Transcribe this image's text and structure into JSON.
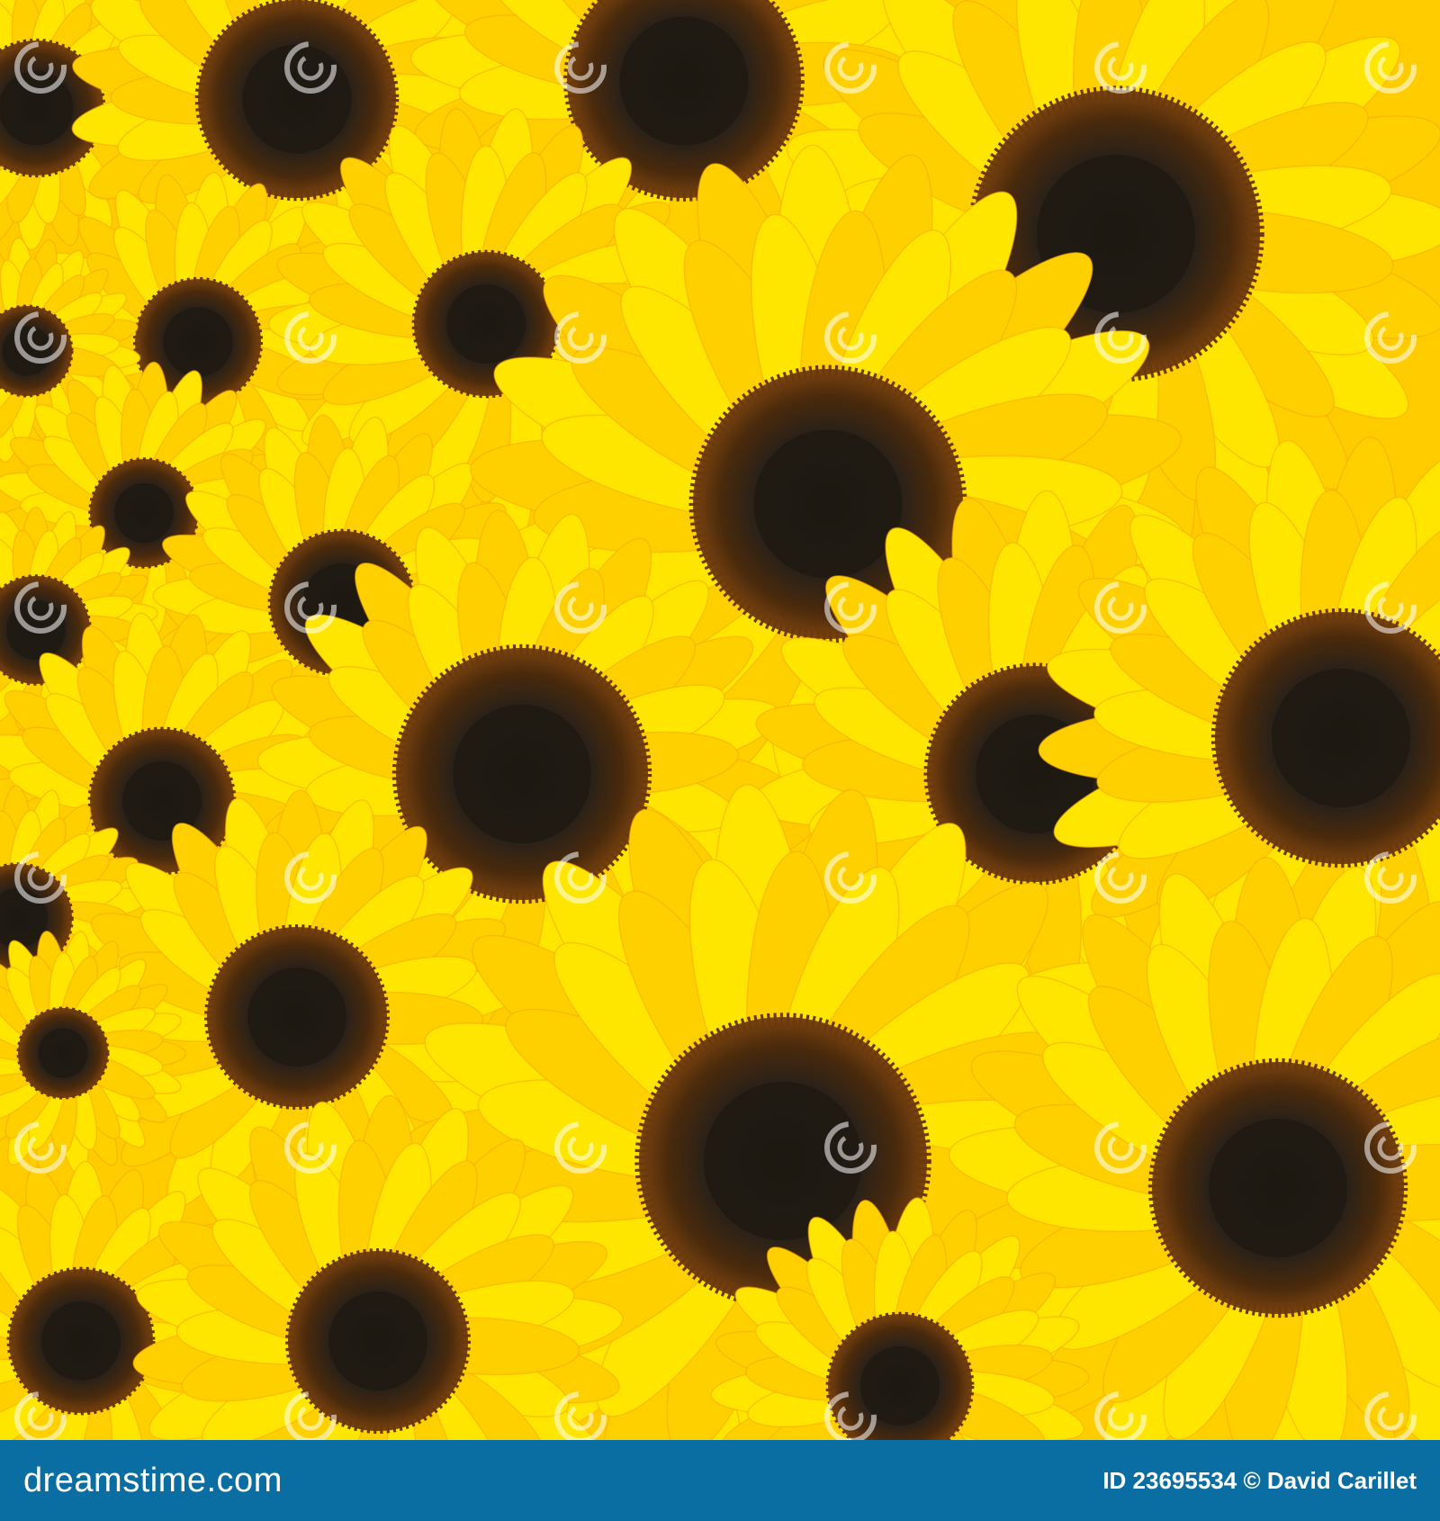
{
  "image": {
    "subject": "sunflowers",
    "colors": {
      "petal_light": "#ffe600",
      "petal_mid": "#ffd000",
      "petal_deep": "#f7a800",
      "disc_outer": "#6b3a0c",
      "disc_inner": "#1f1a12",
      "background_fill": "#ffcc00",
      "footer_bg": "#0b6ea2",
      "footer_text": "#ffffff"
    },
    "watermark_text": "dreamstime"
  },
  "footer": {
    "brand": "dreamstime.com",
    "credit": "ID 23695534 © David Carillet"
  }
}
